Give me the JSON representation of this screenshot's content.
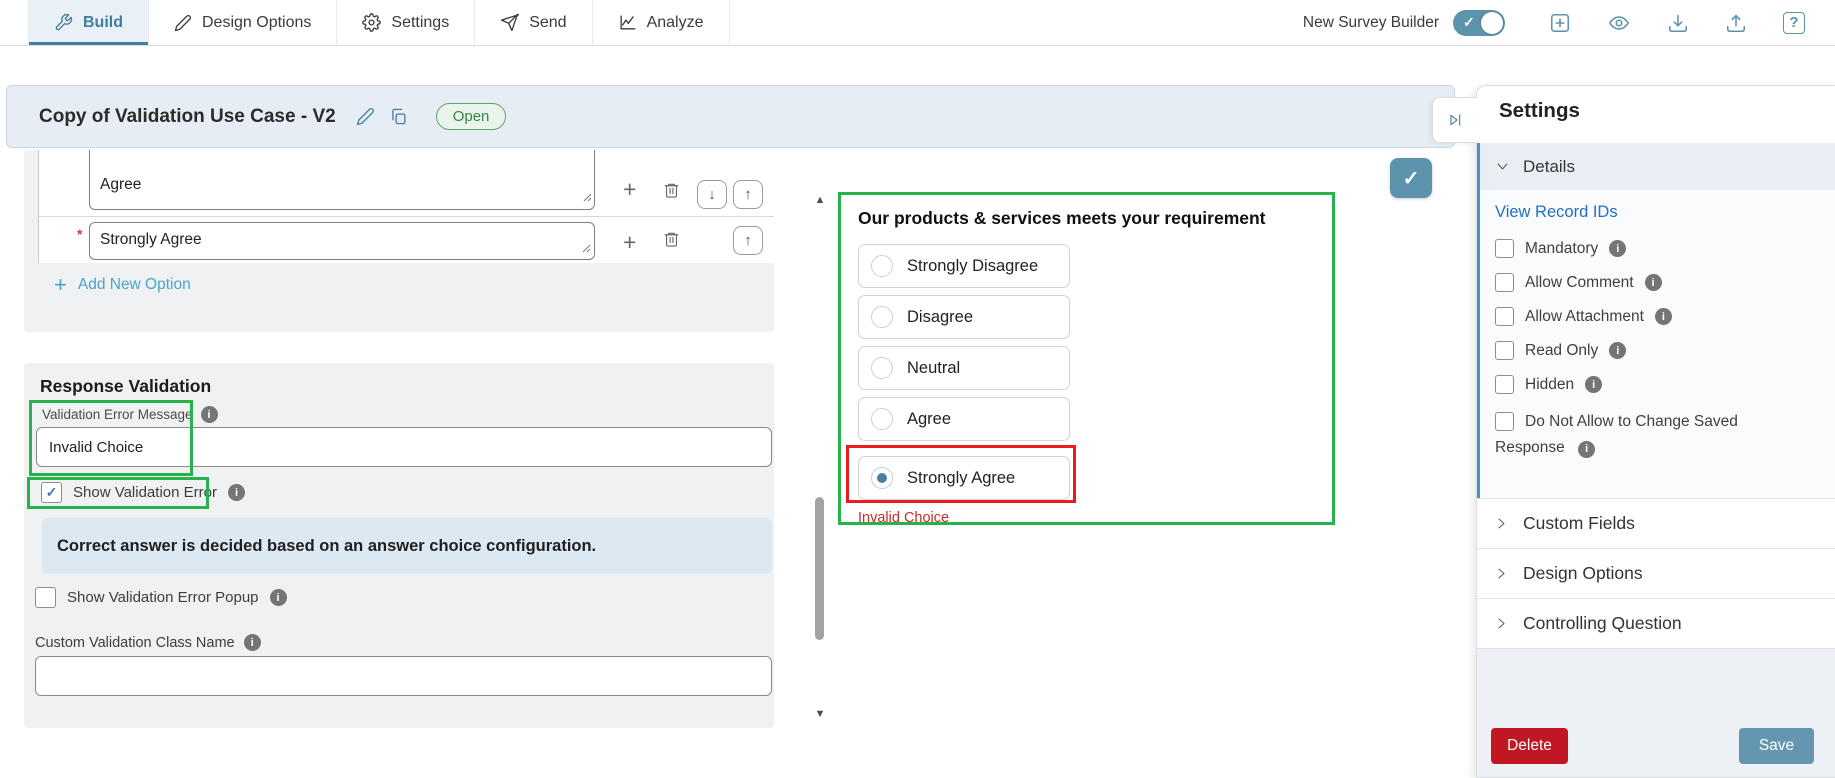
{
  "topbar": {
    "tabs": [
      {
        "label": "Build"
      },
      {
        "label": "Design Options"
      },
      {
        "label": "Settings"
      },
      {
        "label": "Send"
      },
      {
        "label": "Analyze"
      }
    ],
    "active_tab": "Build",
    "toggle_label": "New Survey Builder",
    "toggle_state": "on"
  },
  "header": {
    "title": "Copy of Validation Use Case - V2",
    "status_badge": "Open"
  },
  "options_editor": {
    "rows": [
      {
        "value": "Agree",
        "required": false
      },
      {
        "value": "Strongly Agree",
        "required": true
      }
    ],
    "add_new_option_label": "Add New Option"
  },
  "validation": {
    "heading": "Response Validation",
    "error_message_label": "Validation Error Message",
    "error_message_value": "Invalid Choice",
    "show_error_label": "Show Validation Error",
    "show_error_checked": true,
    "info_banner": "Correct answer is decided based on an answer choice configuration.",
    "show_popup_label": "Show Validation Error Popup",
    "show_popup_checked": false,
    "custom_class_label": "Custom Validation Class Name",
    "custom_class_value": ""
  },
  "preview": {
    "question": "Our products & services meets your requirement",
    "options": [
      "Strongly Disagree",
      "Disagree",
      "Neutral",
      "Agree",
      "Strongly Agree"
    ],
    "selected_option": "Strongly Agree",
    "error_text": "Invalid Choice"
  },
  "settings_panel": {
    "title": "Settings",
    "details": {
      "label": "Details",
      "expanded": true,
      "link": "View Record IDs",
      "checkboxes": [
        {
          "label": "Mandatory",
          "checked": false
        },
        {
          "label": "Allow Comment",
          "checked": false
        },
        {
          "label": "Allow Attachment",
          "checked": false
        },
        {
          "label": "Read Only",
          "checked": false
        },
        {
          "label": "Hidden",
          "checked": false
        },
        {
          "label": "Do Not Allow to Change Saved Response",
          "checked": false
        }
      ]
    },
    "collapsed_sections": [
      {
        "label": "Custom Fields"
      },
      {
        "label": "Design Options"
      },
      {
        "label": "Controlling Question"
      }
    ],
    "delete_label": "Delete",
    "save_label": "Save"
  },
  "icons": {
    "plus": "+",
    "arrow_up": "↑",
    "arrow_down": "↓",
    "scroll_up": "▲",
    "scroll_down": "▼",
    "check": "✓",
    "question_mark": "?",
    "info": "i",
    "required_asterisk": "*"
  },
  "colors": {
    "accent_teal": "#5E93AD",
    "active_tab": "#44809C",
    "annotation_green": "#27B24B",
    "annotation_red": "#EA1B22",
    "error_text": "#C22F2A",
    "delete_red": "#C01723",
    "save_blue": "#6596B0",
    "link_blue": "#2170C4",
    "add_option_blue": "#4BA4CA",
    "details_accent": "#4A90C9",
    "open_badge_green": "#4E9D5F"
  }
}
